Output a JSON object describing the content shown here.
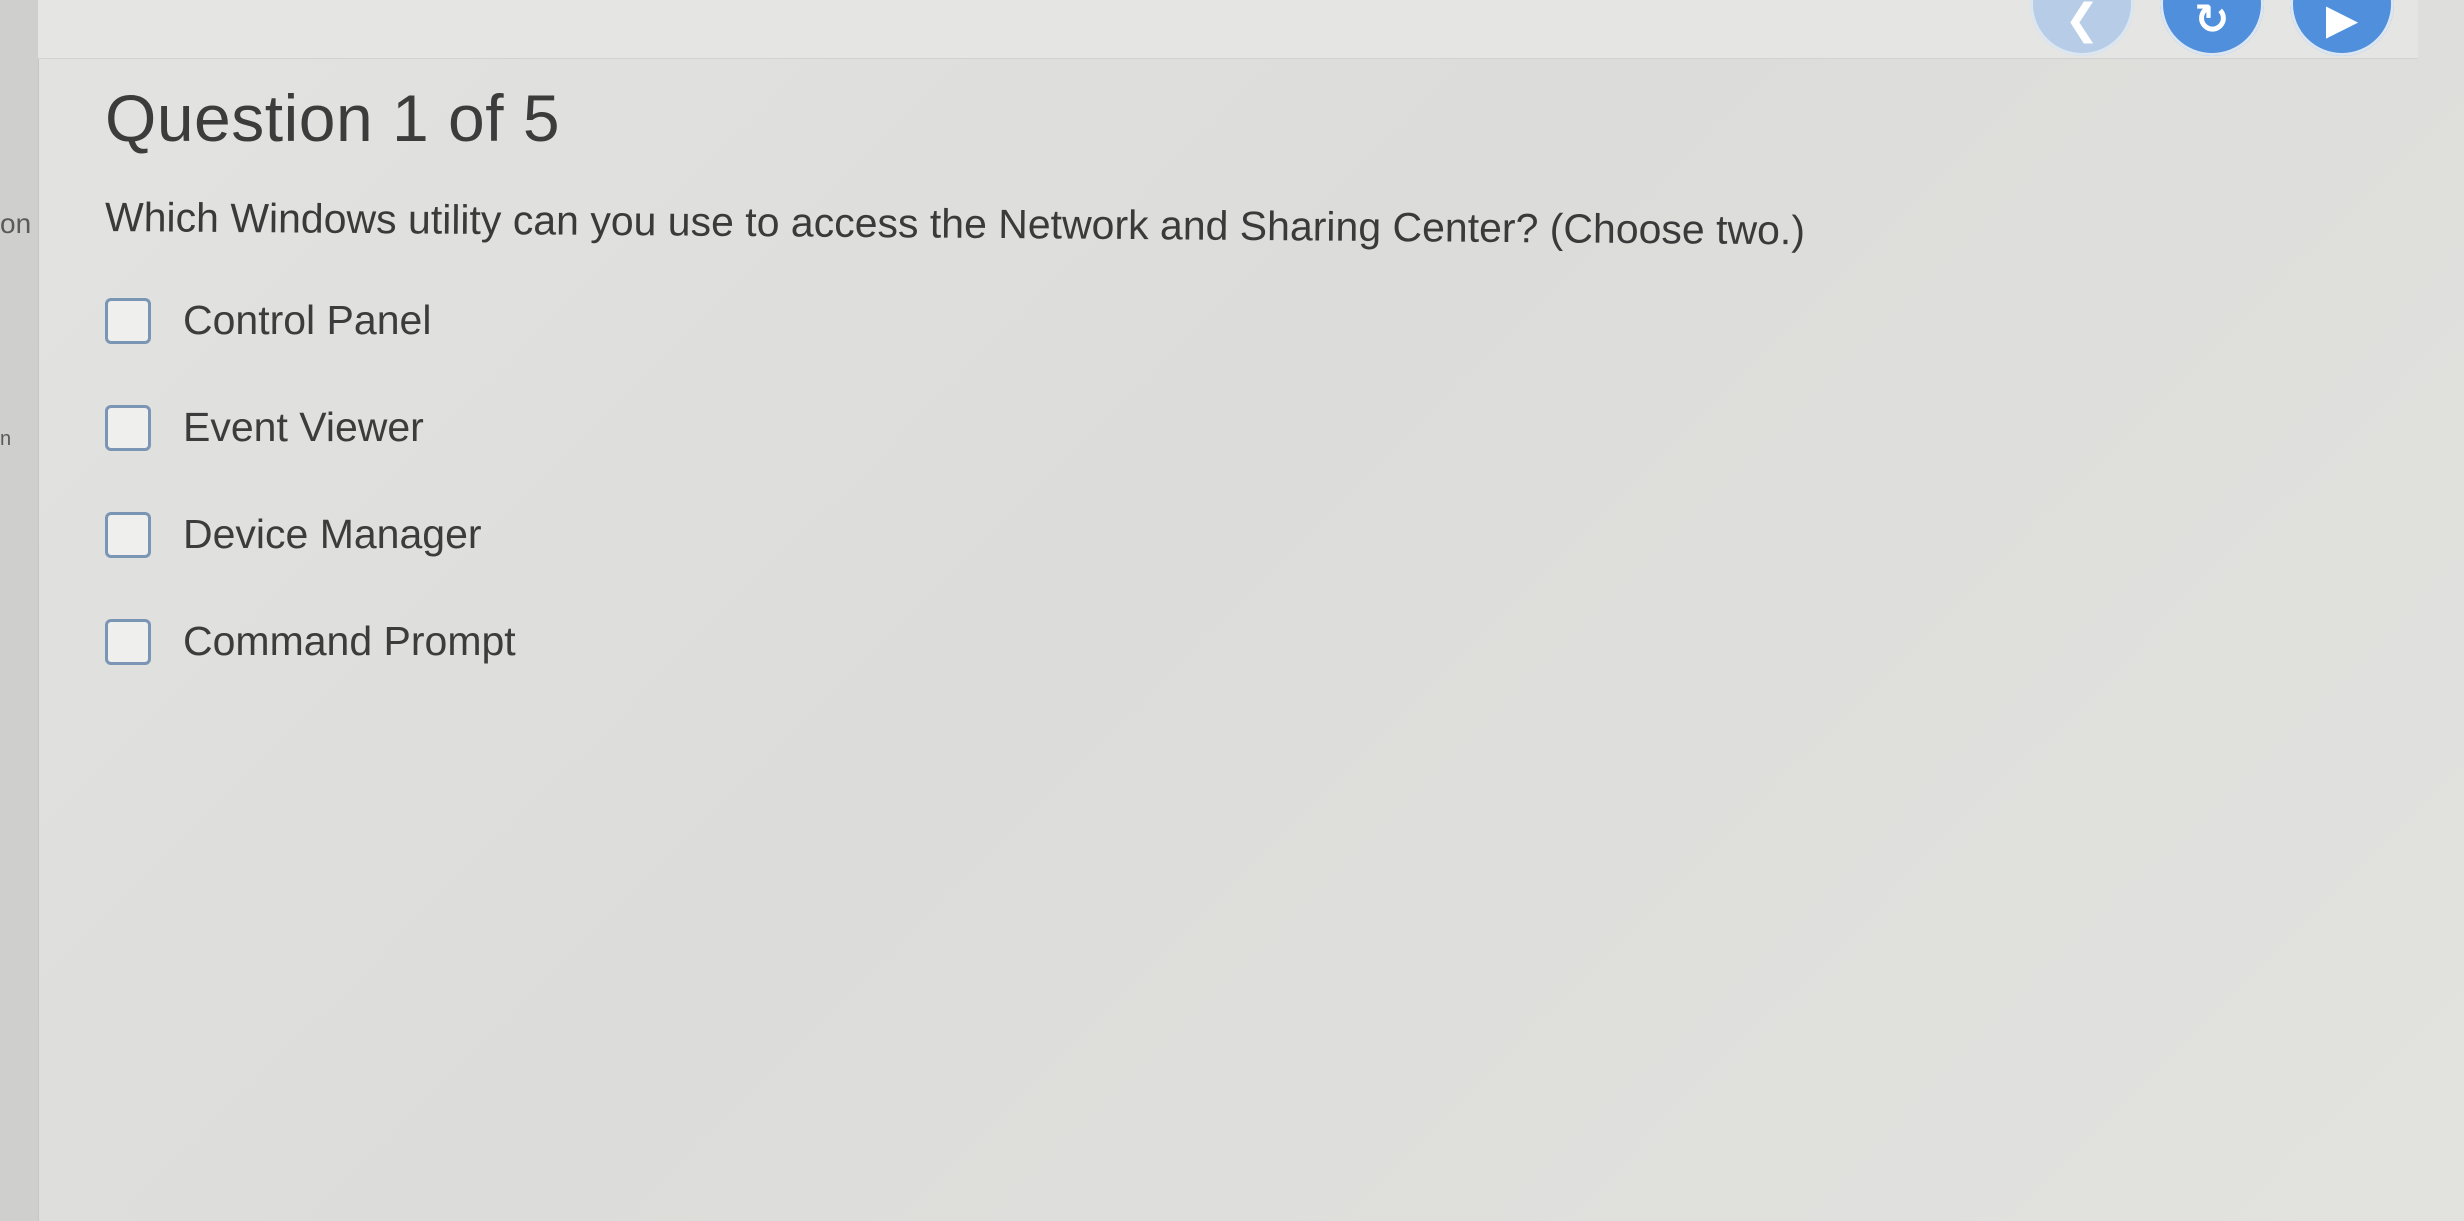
{
  "sidebar": {
    "fragments": [
      "on",
      "n"
    ]
  },
  "nav": {
    "back_icon": "chevron-left-icon",
    "reload_icon": "refresh-icon",
    "next_icon": "play-arrow-icon",
    "accent_color": "#4f8fdc"
  },
  "question": {
    "title": "Question 1 of 5",
    "text": "Which Windows utility can you use to access the Network and Sharing Center? (Choose two.)",
    "options": [
      {
        "label": "Control Panel",
        "checked": false
      },
      {
        "label": "Event Viewer",
        "checked": false
      },
      {
        "label": "Device Manager",
        "checked": false
      },
      {
        "label": "Command Prompt",
        "checked": false
      }
    ]
  }
}
